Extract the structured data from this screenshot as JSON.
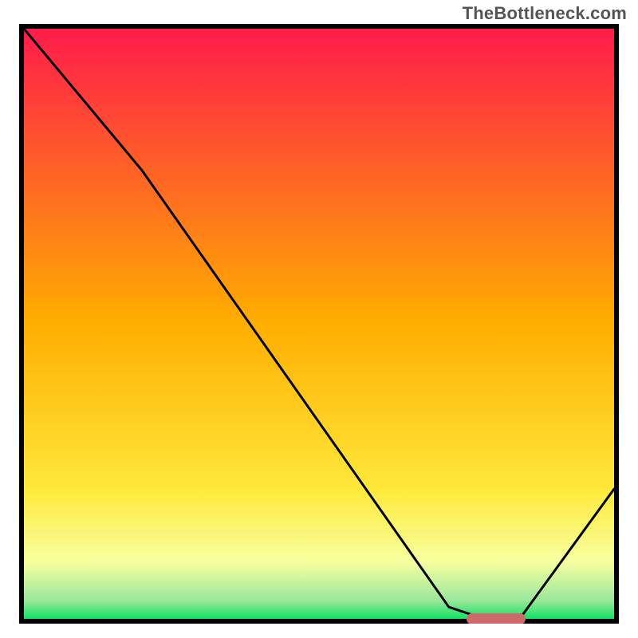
{
  "watermark": "TheBottleneck.com",
  "chart_data": {
    "type": "line",
    "title": "",
    "xlabel": "",
    "ylabel": "",
    "xlim": [
      0,
      100
    ],
    "ylim": [
      0,
      100
    ],
    "series": [
      {
        "name": "curve",
        "x": [
          0,
          20,
          72,
          78,
          84,
          100
        ],
        "y": [
          100,
          76,
          2,
          0,
          0,
          22
        ]
      }
    ],
    "marker": {
      "name": "optimal-range",
      "x_start": 75,
      "x_end": 85,
      "y": 0,
      "color": "#cf6a6a"
    },
    "background_gradient": {
      "stops": [
        {
          "offset": 0.0,
          "color": "#ff1a4b"
        },
        {
          "offset": 0.5,
          "color": "#ffae00"
        },
        {
          "offset": 0.78,
          "color": "#ffe93b"
        },
        {
          "offset": 0.9,
          "color": "#f7ffa0"
        },
        {
          "offset": 0.965,
          "color": "#9be89b"
        },
        {
          "offset": 1.0,
          "color": "#00e05a"
        }
      ]
    },
    "frame_color": "#000000"
  }
}
